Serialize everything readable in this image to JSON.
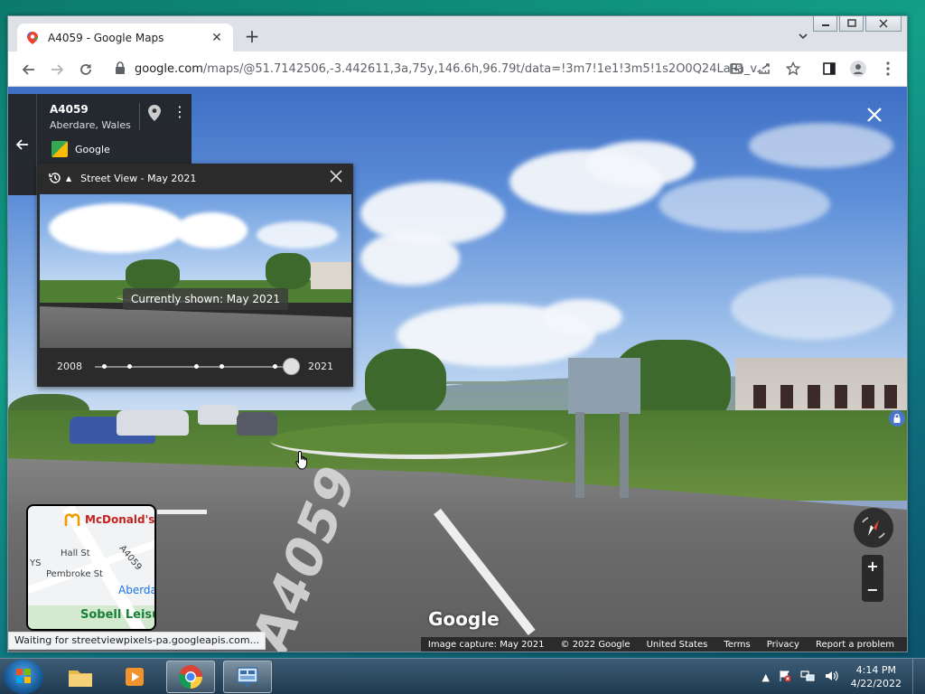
{
  "browser": {
    "tab_title": "A4059 - Google Maps",
    "tab_close": "✕",
    "new_tab": "+",
    "url_host": "google.com",
    "url_path": "/maps/@51.7142506,-3.442611,3a,75y,146.6h,96.79t/data=!3m7!1e1!3m5!1s2O0Q24LaPa_v..."
  },
  "infocard": {
    "title": "A4059",
    "subtitle": "Aberdare, Wales",
    "provider": "Google"
  },
  "timepanel": {
    "header": "Street View - May 2021",
    "badge": "Currently shown: May 2021",
    "year_start": "2008",
    "year_end": "2021",
    "selected_fraction": 1.0
  },
  "minimap": {
    "labels": {
      "mcdonalds": "McDonald's",
      "hall_st": "Hall St",
      "pembroke_st": "Pembroke St",
      "a4059": "A4059",
      "ys": "YS",
      "aberdare": "Aberda",
      "sobell": "Sobell Leisur"
    }
  },
  "streetview": {
    "road_marking": "A4059",
    "watermark": "Google",
    "status": "Waiting for streetviewpixels-pa.googleapis.com...",
    "attribution": [
      "Image capture: May 2021",
      "© 2022 Google",
      "United States",
      "Terms",
      "Privacy",
      "Report a problem"
    ],
    "zoom_in": "+",
    "zoom_out": "−"
  },
  "taskbar": {
    "time": "4:14 PM",
    "date": "4/22/2022"
  }
}
